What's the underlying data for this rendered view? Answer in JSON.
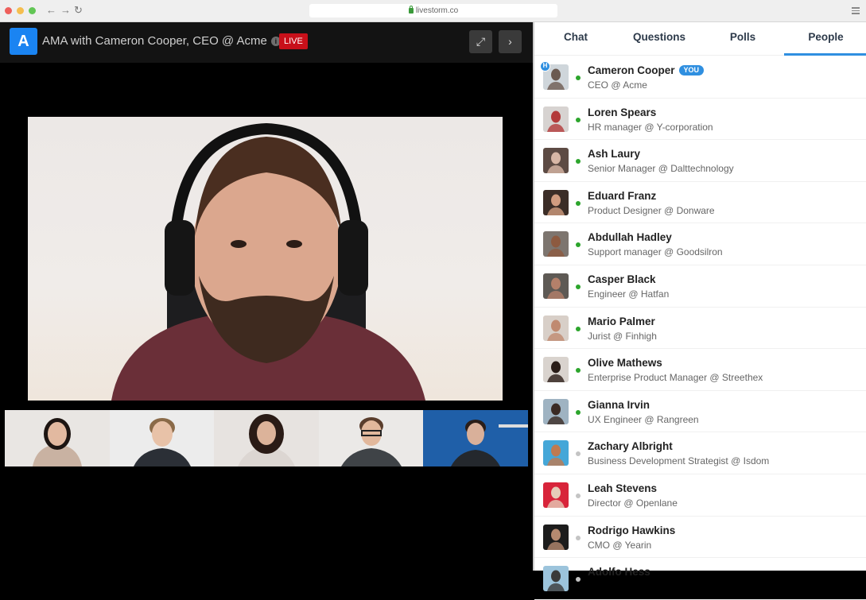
{
  "browser": {
    "url": "livestorm.co",
    "back": "←",
    "forward": "→",
    "reload": "↻"
  },
  "header": {
    "logo_letter": "A",
    "title": "AMA with Cameron Cooper, CEO @ Acme",
    "info_glyph": "i",
    "live_label": "LIVE",
    "expand_glyph": "⤢",
    "next_glyph": "›"
  },
  "video": {
    "main_speaker": "Cameron Cooper",
    "thumbnails": [
      {
        "bg": "#e9e6e3",
        "shirt": "#c9b2a2",
        "hair": "#1d1512",
        "skin": "#e2b9a0"
      },
      {
        "bg": "#ececec",
        "shirt": "#2b2f36",
        "hair": "#8a6a48",
        "skin": "#e8c2a8"
      },
      {
        "bg": "#e7e3e0",
        "shirt": "#dcd6d2",
        "hair": "#2a1b16",
        "skin": "#dcb39a"
      },
      {
        "bg": "#ebe9e7",
        "shirt": "#3f4347",
        "hair": "#5a3d2c",
        "skin": "#e2b89c"
      },
      {
        "bg": "#1f5fa8",
        "shirt": "#24282d",
        "hair": "#2b1e18",
        "skin": "#d9b09a"
      }
    ]
  },
  "sidebar": {
    "tabs": [
      {
        "label": "Chat",
        "active": false
      },
      {
        "label": "Questions",
        "active": false
      },
      {
        "label": "Polls",
        "active": false
      },
      {
        "label": "People",
        "active": true
      }
    ],
    "host_badge": "H",
    "you_badge": "YOU",
    "people": [
      {
        "name": "Cameron Cooper",
        "role": "CEO @ Acme",
        "online": true,
        "host": true,
        "you": true,
        "avatar_bg": "#cfd6db",
        "avatar_fg": "#6b5a50"
      },
      {
        "name": "Loren Spears",
        "role": "HR manager @ Y-corporation",
        "online": true,
        "avatar_bg": "#d7d3d1",
        "avatar_fg": "#b33a3a"
      },
      {
        "name": "Ash Laury",
        "role": "Senior Manager @ Dalttechnology",
        "online": true,
        "avatar_bg": "#5d4b44",
        "avatar_fg": "#d8b7a6"
      },
      {
        "name": "Eduard Franz",
        "role": "Product Designer @ Donware",
        "online": true,
        "avatar_bg": "#3b2d27",
        "avatar_fg": "#d19c80"
      },
      {
        "name": "Abdullah Hadley",
        "role": "Support manager @ Goodsilron",
        "online": true,
        "avatar_bg": "#7d756f",
        "avatar_fg": "#8d5a40"
      },
      {
        "name": "Casper Black",
        "role": "Engineer @ Hatfan",
        "online": true,
        "avatar_bg": "#5e5a55",
        "avatar_fg": "#b4806a"
      },
      {
        "name": "Mario Palmer",
        "role": "Jurist @ Finhigh",
        "online": true,
        "avatar_bg": "#d8cfc8",
        "avatar_fg": "#c08a70"
      },
      {
        "name": "Olive Mathews",
        "role": "Enterprise Product Manager @ Streethex",
        "online": true,
        "avatar_bg": "#d9d3ce",
        "avatar_fg": "#2a1d18"
      },
      {
        "name": "Gianna Irvin",
        "role": "UX Engineer @ Rangreen",
        "online": true,
        "avatar_bg": "#9fb3c2",
        "avatar_fg": "#3a2a24"
      },
      {
        "name": "Zachary Albright",
        "role": "Business Development Strategist @ Isdom",
        "online": false,
        "avatar_bg": "#45a7d8",
        "avatar_fg": "#c07a50"
      },
      {
        "name": "Leah Stevens",
        "role": "Director @ Openlane",
        "online": false,
        "avatar_bg": "#d8243a",
        "avatar_fg": "#e6cbb8"
      },
      {
        "name": "Rodrigo Hawkins",
        "role": "CMO @ Yearin",
        "online": false,
        "avatar_bg": "#1c1c1c",
        "avatar_fg": "#b58a70"
      },
      {
        "name": "Adolfo Hess",
        "role": "",
        "online": false,
        "avatar_bg": "#9cc4dc",
        "avatar_fg": "#3a3a3a"
      }
    ]
  },
  "colors": {
    "accent": "#2f8fe0",
    "live": "#c8101a",
    "online": "#2ca52c",
    "offline": "#c4c4c4"
  }
}
